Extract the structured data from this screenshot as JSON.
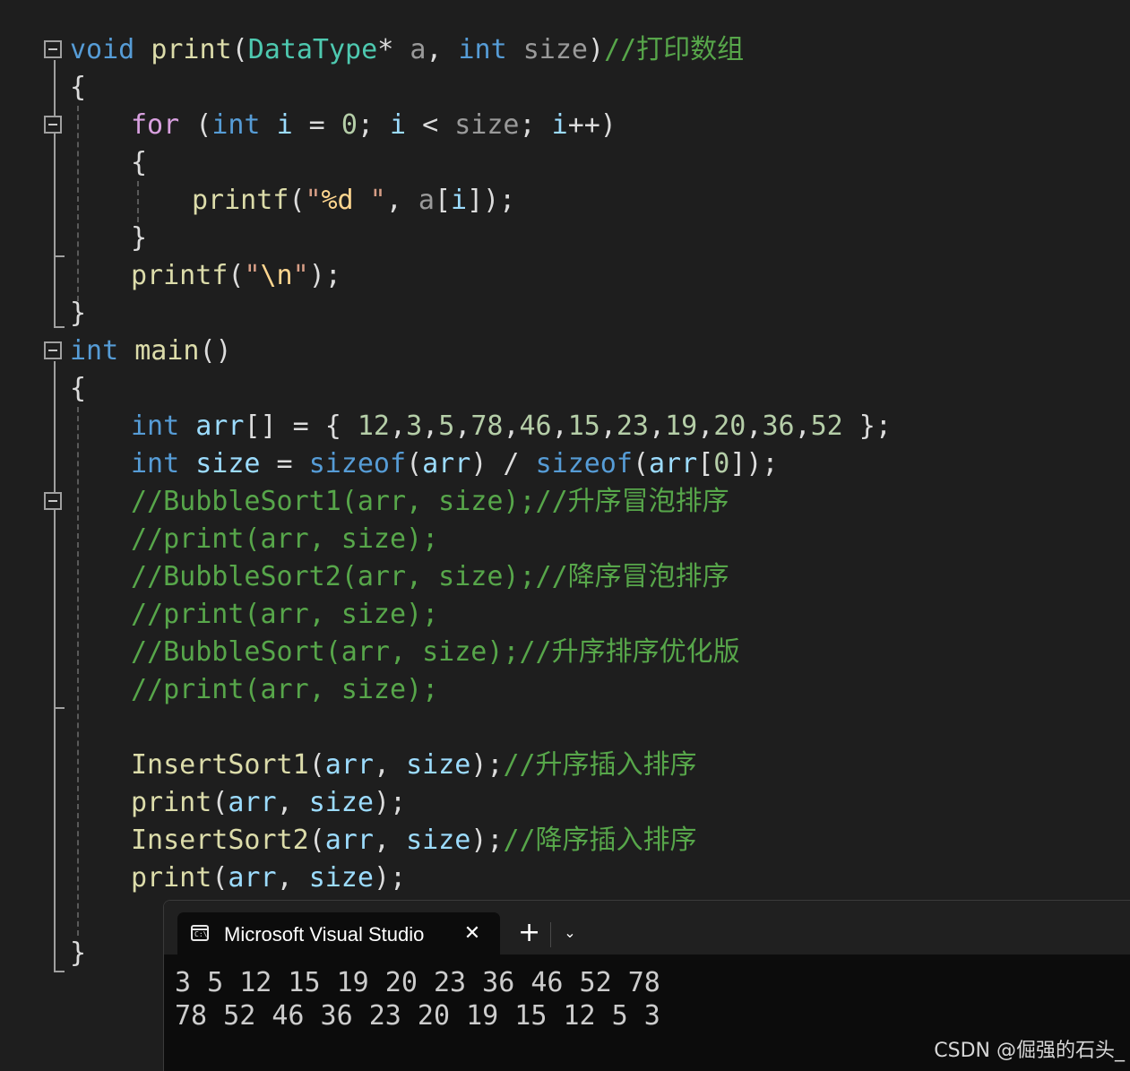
{
  "editor": {
    "lines": [
      [
        [
          "void",
          "kw"
        ],
        [
          " ",
          "op"
        ],
        [
          "print",
          "fn"
        ],
        [
          "(",
          "op"
        ],
        [
          "DataType",
          "type"
        ],
        [
          "* ",
          "op"
        ],
        [
          "a",
          "param"
        ],
        [
          ", ",
          "op"
        ],
        [
          "int",
          "kw"
        ],
        [
          " ",
          "op"
        ],
        [
          "size",
          "param"
        ],
        [
          ")",
          "op"
        ],
        [
          "//打印数组",
          "cmt"
        ]
      ],
      [
        [
          "{",
          "op"
        ]
      ],
      [
        [
          "for",
          "ctl"
        ],
        [
          " (",
          "op"
        ],
        [
          "int",
          "kw"
        ],
        [
          " ",
          "op"
        ],
        [
          "i",
          "var"
        ],
        [
          " = ",
          "op"
        ],
        [
          "0",
          "num"
        ],
        [
          "; ",
          "op"
        ],
        [
          "i",
          "var"
        ],
        [
          " < ",
          "op"
        ],
        [
          "size",
          "param"
        ],
        [
          "; ",
          "op"
        ],
        [
          "i",
          "var"
        ],
        [
          "++)",
          "op"
        ]
      ],
      [
        [
          "{",
          "op"
        ]
      ],
      [
        [
          "printf",
          "fn"
        ],
        [
          "(",
          "op"
        ],
        [
          "\"",
          "str"
        ],
        [
          "%d",
          "esc"
        ],
        [
          " \"",
          "str"
        ],
        [
          ", ",
          "op"
        ],
        [
          "a",
          "param"
        ],
        [
          "[",
          "op"
        ],
        [
          "i",
          "var"
        ],
        [
          "]);",
          "op"
        ]
      ],
      [
        [
          "}",
          "op"
        ]
      ],
      [
        [
          "printf",
          "fn"
        ],
        [
          "(",
          "op"
        ],
        [
          "\"",
          "str"
        ],
        [
          "\\n",
          "esc"
        ],
        [
          "\"",
          "str"
        ],
        [
          ");",
          "op"
        ]
      ],
      [
        [
          "}",
          "op"
        ]
      ],
      [
        [
          "int",
          "kw"
        ],
        [
          " ",
          "op"
        ],
        [
          "main",
          "fn"
        ],
        [
          "()",
          "op"
        ]
      ],
      [
        [
          "{",
          "op"
        ]
      ],
      [
        [
          "int",
          "kw"
        ],
        [
          " ",
          "op"
        ],
        [
          "arr",
          "var"
        ],
        [
          "[] = { ",
          "op"
        ],
        [
          "12",
          "num"
        ],
        [
          ",",
          "op"
        ],
        [
          "3",
          "num"
        ],
        [
          ",",
          "op"
        ],
        [
          "5",
          "num"
        ],
        [
          ",",
          "op"
        ],
        [
          "78",
          "num"
        ],
        [
          ",",
          "op"
        ],
        [
          "46",
          "num"
        ],
        [
          ",",
          "op"
        ],
        [
          "15",
          "num"
        ],
        [
          ",",
          "op"
        ],
        [
          "23",
          "num"
        ],
        [
          ",",
          "op"
        ],
        [
          "19",
          "num"
        ],
        [
          ",",
          "op"
        ],
        [
          "20",
          "num"
        ],
        [
          ",",
          "op"
        ],
        [
          "36",
          "num"
        ],
        [
          ",",
          "op"
        ],
        [
          "52",
          "num"
        ],
        [
          " };",
          "op"
        ]
      ],
      [
        [
          "int",
          "kw"
        ],
        [
          " ",
          "op"
        ],
        [
          "size",
          "var"
        ],
        [
          " = ",
          "op"
        ],
        [
          "sizeof",
          "kw"
        ],
        [
          "(",
          "op"
        ],
        [
          "arr",
          "var"
        ],
        [
          ") / ",
          "op"
        ],
        [
          "sizeof",
          "kw"
        ],
        [
          "(",
          "op"
        ],
        [
          "arr",
          "var"
        ],
        [
          "[",
          "op"
        ],
        [
          "0",
          "num"
        ],
        [
          "]);",
          "op"
        ]
      ],
      [
        [
          "//BubbleSort1(arr, size);//升序冒泡排序",
          "cmt"
        ]
      ],
      [
        [
          "//print(arr, size);",
          "cmt"
        ]
      ],
      [
        [
          "//BubbleSort2(arr, size);//降序冒泡排序",
          "cmt"
        ]
      ],
      [
        [
          "//print(arr, size);",
          "cmt"
        ]
      ],
      [
        [
          "//BubbleSort(arr, size);//升序排序优化版",
          "cmt"
        ]
      ],
      [
        [
          "//print(arr, size);",
          "cmt"
        ]
      ],
      [],
      [
        [
          "InsertSort1",
          "fn"
        ],
        [
          "(",
          "op"
        ],
        [
          "arr",
          "var"
        ],
        [
          ", ",
          "op"
        ],
        [
          "size",
          "var"
        ],
        [
          ");",
          "op"
        ],
        [
          "//升序插入排序",
          "cmt"
        ]
      ],
      [
        [
          "print",
          "fn"
        ],
        [
          "(",
          "op"
        ],
        [
          "arr",
          "var"
        ],
        [
          ", ",
          "op"
        ],
        [
          "size",
          "var"
        ],
        [
          ");",
          "op"
        ]
      ],
      [
        [
          "InsertSort2",
          "fn"
        ],
        [
          "(",
          "op"
        ],
        [
          "arr",
          "var"
        ],
        [
          ", ",
          "op"
        ],
        [
          "size",
          "var"
        ],
        [
          ");",
          "op"
        ],
        [
          "//降序插入排序",
          "cmt"
        ]
      ],
      [
        [
          "print",
          "fn"
        ],
        [
          "(",
          "op"
        ],
        [
          "arr",
          "var"
        ],
        [
          ", ",
          "op"
        ],
        [
          "size",
          "var"
        ],
        [
          ");",
          "op"
        ]
      ],
      [],
      [
        [
          "}",
          "op"
        ]
      ]
    ]
  },
  "console": {
    "tab_icon_glyph": "C:\\",
    "tab_title": "Microsoft Visual Studio",
    "close_glyph": "✕",
    "new_tab_glyph": "+",
    "dropdown_glyph": "⌄",
    "output": [
      "3 5 12 15 19 20 23 36 46 52 78",
      "78 52 46 36 23 20 19 15 12 5 3"
    ]
  },
  "watermark": "CSDN @倔强的石头_",
  "icons": {
    "fold_markers": "collapse-icon",
    "terminal": "terminal-icon",
    "close": "close-icon",
    "new_tab": "plus-icon",
    "dropdown": "chevron-down-icon"
  },
  "colors": {
    "background": "#1e1e1e",
    "keyword": "#569cd6",
    "control": "#d8a0df",
    "function": "#dcdcaa",
    "type": "#4ec9b0",
    "variable": "#9cdcfe",
    "number": "#b5cea8",
    "string": "#d69d85",
    "escape": "#ffd68f",
    "comment": "#57a64a",
    "console_bg": "#0c0c0c"
  }
}
